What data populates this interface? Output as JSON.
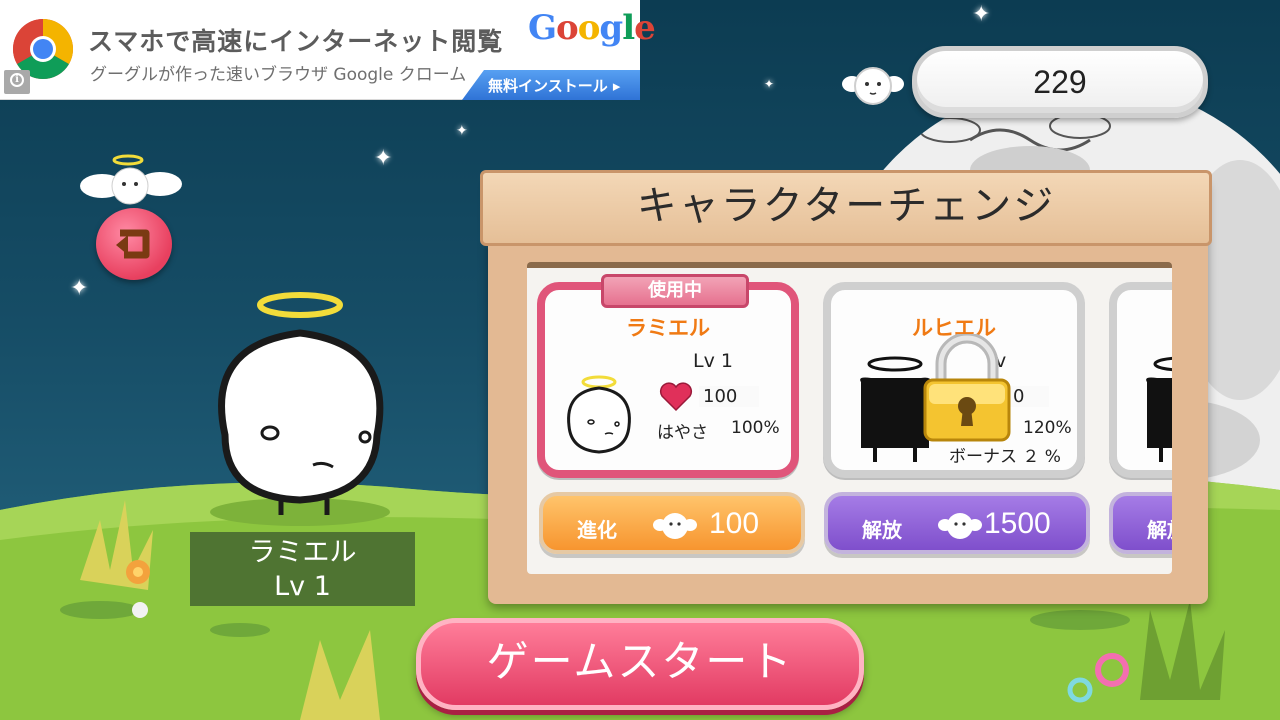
{
  "ad": {
    "headline": "スマホで高速にインターネット閲覧",
    "subline": "グーグルが作った速いブラウザ Google クローム",
    "brand": "Google",
    "cta": "無料インストール ▸",
    "info_icon": "info-icon",
    "logo_icon": "chrome-logo-icon"
  },
  "currency": {
    "amount": "229",
    "icon": "angel-coin-icon"
  },
  "back": {
    "icon": "back-arrow-icon"
  },
  "main_character": {
    "name": "ラミエル",
    "level": "Lv  1"
  },
  "panel": {
    "title": "キャラクターチェンジ",
    "cards": [
      {
        "tag": "使用中",
        "name": "ラミエル",
        "level": "Lv 1",
        "hp": "100",
        "speed_label": "はやさ",
        "speed": "100%",
        "button_label": "進化",
        "button_cost": "100"
      },
      {
        "name": "ルヒエル",
        "level": "v",
        "hp": "0",
        "speed": "120%",
        "bonus": "ボーナス ２ %",
        "button_label": "解放",
        "button_cost": "1500",
        "locked": true
      },
      {
        "button_label": "解放"
      }
    ]
  },
  "start_button": "ゲームスタート",
  "colors": {
    "sky": "#164d66",
    "ground": "#8dc63f",
    "start": "#e23b63",
    "evolve": "#f7952f",
    "unlock": "#7f4fcc",
    "name_orange": "#f07a14"
  }
}
